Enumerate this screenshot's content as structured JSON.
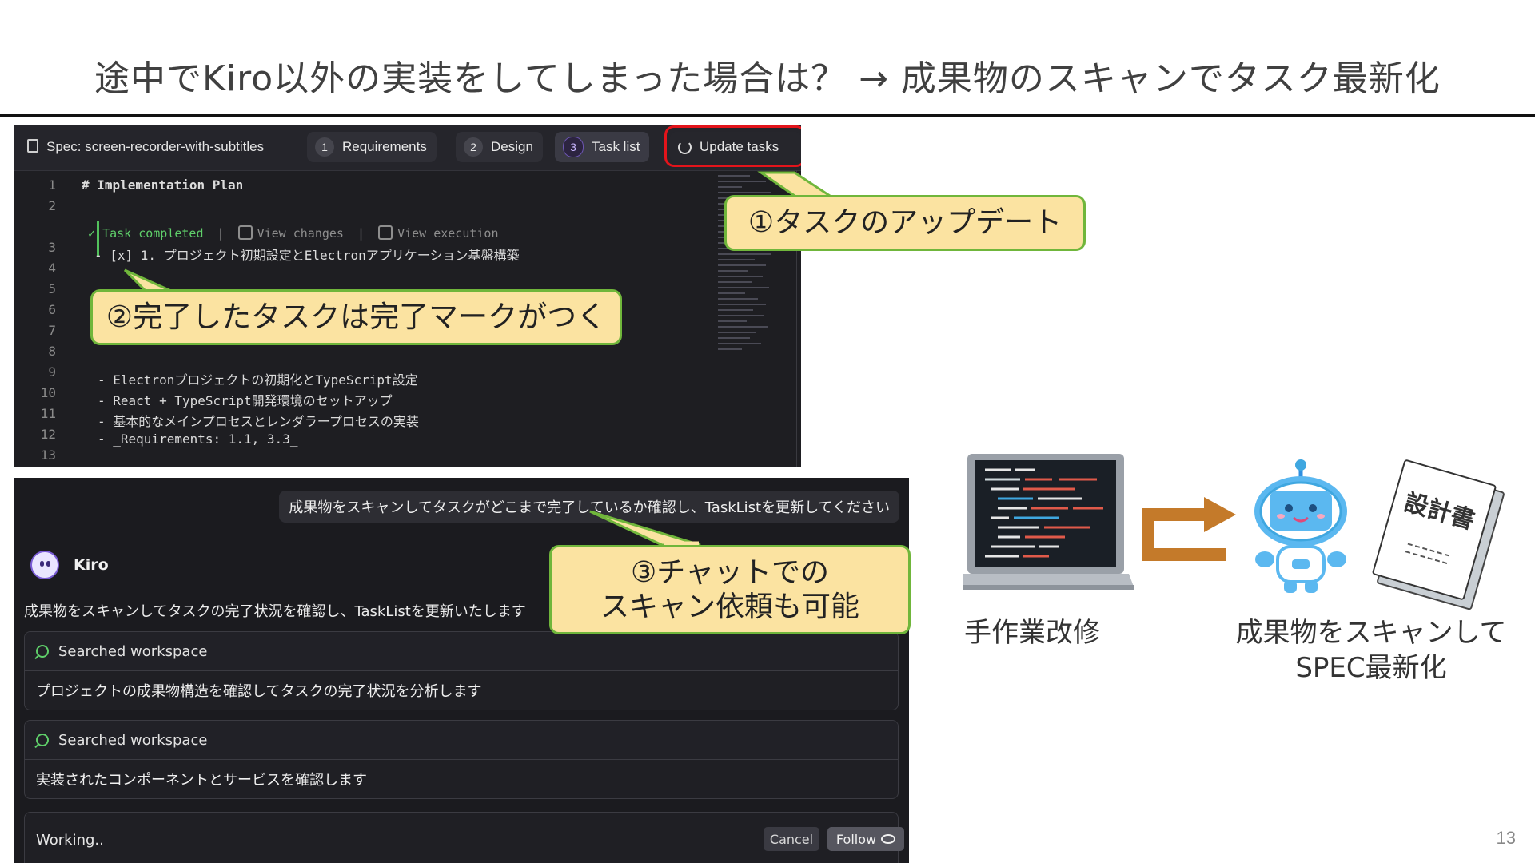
{
  "slide": {
    "title": "途中でKiro以外の実装をしてしまった場合は？ → 成果物のスキャンでタスク最新化",
    "page_number": "13"
  },
  "editor": {
    "spec_label": "Spec: screen-recorder-with-subtitles",
    "tabs": [
      {
        "num": "1",
        "label": "Requirements"
      },
      {
        "num": "2",
        "label": "Design"
      },
      {
        "num": "3",
        "label": "Task list"
      }
    ],
    "update_label": "Update tasks",
    "line_numbers": [
      "1",
      "2",
      "3",
      "4",
      "5",
      "6",
      "7",
      "8",
      "9",
      "10",
      "11",
      "12",
      "13"
    ],
    "heading": "# Implementation Plan",
    "task_status": "Task completed",
    "view_changes": "View changes",
    "view_execution": "View execution",
    "task_line": "- [x] 1. プロジェクト初期設定とElectronアプリケーション基盤構築",
    "bullets": [
      "- Electronプロジェクトの初期化とTypeScript設定",
      "- React + TypeScript開発環境のセットアップ",
      "- 基本的なメインプロセスとレンダラープロセスの実装"
    ],
    "req_prefix": "- ",
    "req_text": "_Requirements: 1.1, 3.3_"
  },
  "callouts": {
    "c1": "①タスクのアップデート",
    "c2": "②完了したタスクは完了マークがつく",
    "c3_line1": "③チャットでの",
    "c3_line2": "スキャン依頼も可能"
  },
  "chat": {
    "user_message": "成果物をスキャンしてタスクがどこまで完了しているか確認し、TaskListを更新してください",
    "agent_name": "Kiro",
    "agent_reply": "成果物をスキャンしてタスクの完了状況を確認し、TaskListを更新いたします",
    "tool_calls": [
      {
        "head": "Searched workspace",
        "body": "プロジェクトの成果物構造を確認してタスクの完了状況を分析します"
      },
      {
        "head": "Searched workspace",
        "body": "実装されたコンポーネントとサービスを確認します"
      }
    ],
    "status": "Working..",
    "cancel_label": "Cancel",
    "follow_label": "Follow"
  },
  "illustration": {
    "left_caption": "手作業改修",
    "right_caption_line1": "成果物をスキャンして",
    "right_caption_line2": "SPEC最新化",
    "doc_title": "設計書"
  },
  "colors": {
    "callout_fill": "#fbe3a1",
    "callout_border": "#70b63b",
    "highlight_ring": "#e3141b",
    "arrow": "#c47a2a"
  }
}
